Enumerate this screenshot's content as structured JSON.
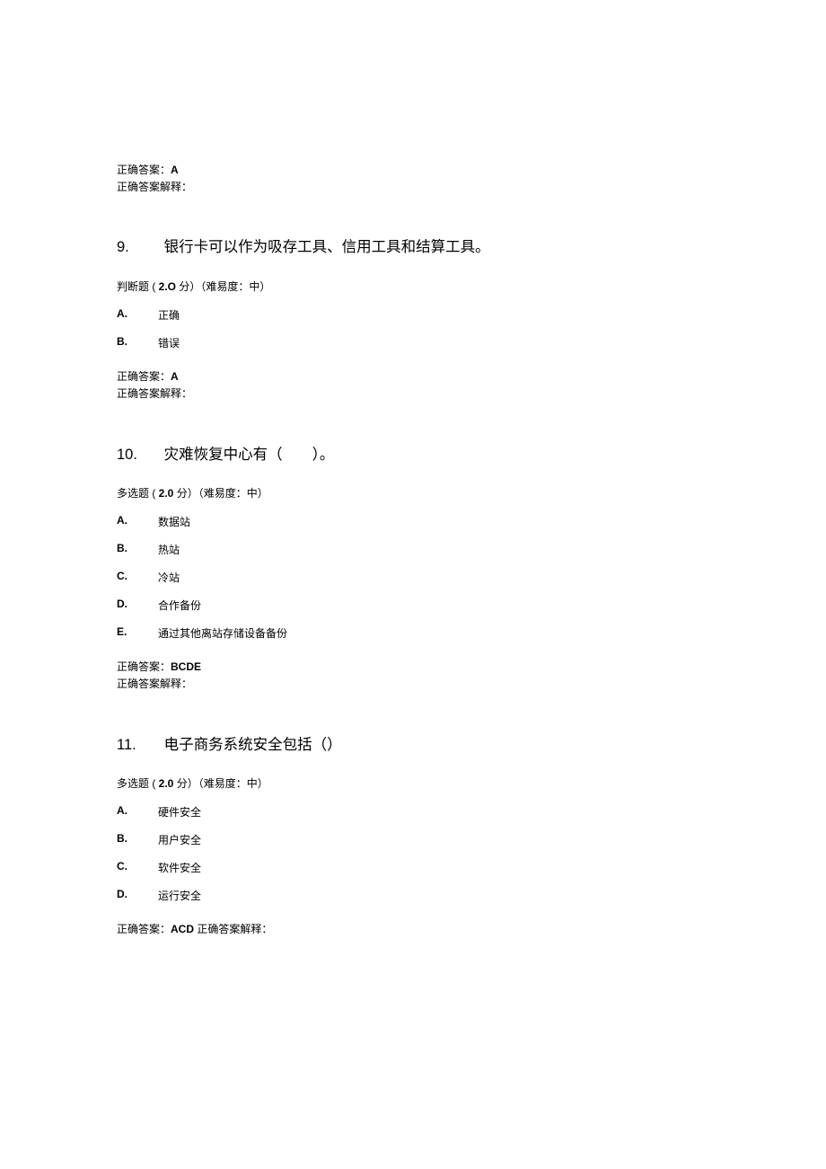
{
  "top_answer": {
    "prefix1": "正确答案：",
    "value1": "A",
    "prefix2": "正确答案解释：",
    "value2": ""
  },
  "q9": {
    "number": "9.",
    "title": "银行卡可以作为吸存工具、信用工具和结算工具。",
    "meta_open": "判断题 (",
    "meta_points_num": " 2.O ",
    "meta_points_suffix": "分）（难易度：中）",
    "options": [
      {
        "letter": "A.",
        "text": "正确"
      },
      {
        "letter": "B.",
        "text": "错误"
      }
    ],
    "answer_prefix": "正确答案：",
    "answer_value": "A",
    "explain_prefix": "正确答案解释：",
    "explain_value": ""
  },
  "q10": {
    "number": "10.",
    "title": "灾难恢复中心有（  ）。",
    "meta_open": "多选题 (",
    "meta_points_num": " 2.0 ",
    "meta_points_suffix": "分）（难易度：中）",
    "options": [
      {
        "letter": "A.",
        "text": "数据站"
      },
      {
        "letter": "B.",
        "text": "热站"
      },
      {
        "letter": "C.",
        "text": "冷站"
      },
      {
        "letter": "D.",
        "text": "合作备份"
      },
      {
        "letter": "E.",
        "text": "通过其他离站存储设备备份"
      }
    ],
    "answer_prefix": "正确答案：",
    "answer_value": "BCDE",
    "explain_prefix": "正确答案解释：",
    "explain_value": ""
  },
  "q11": {
    "number": "11.",
    "title": "电子商务系统安全包括（）",
    "meta_open": "多选题 (",
    "meta_points_num": " 2.0 ",
    "meta_points_suffix": "分）（难易度：中）",
    "options": [
      {
        "letter": "A.",
        "text": "硬件安全"
      },
      {
        "letter": "B.",
        "text": "用户安全"
      },
      {
        "letter": "C.",
        "text": "软件安全"
      },
      {
        "letter": "D.",
        "text": "运行安全"
      }
    ],
    "answer_prefix": "正确答案：",
    "answer_value": "ACD",
    "explain_prefix_inline": " 正确答案解释：",
    "explain_value": ""
  }
}
